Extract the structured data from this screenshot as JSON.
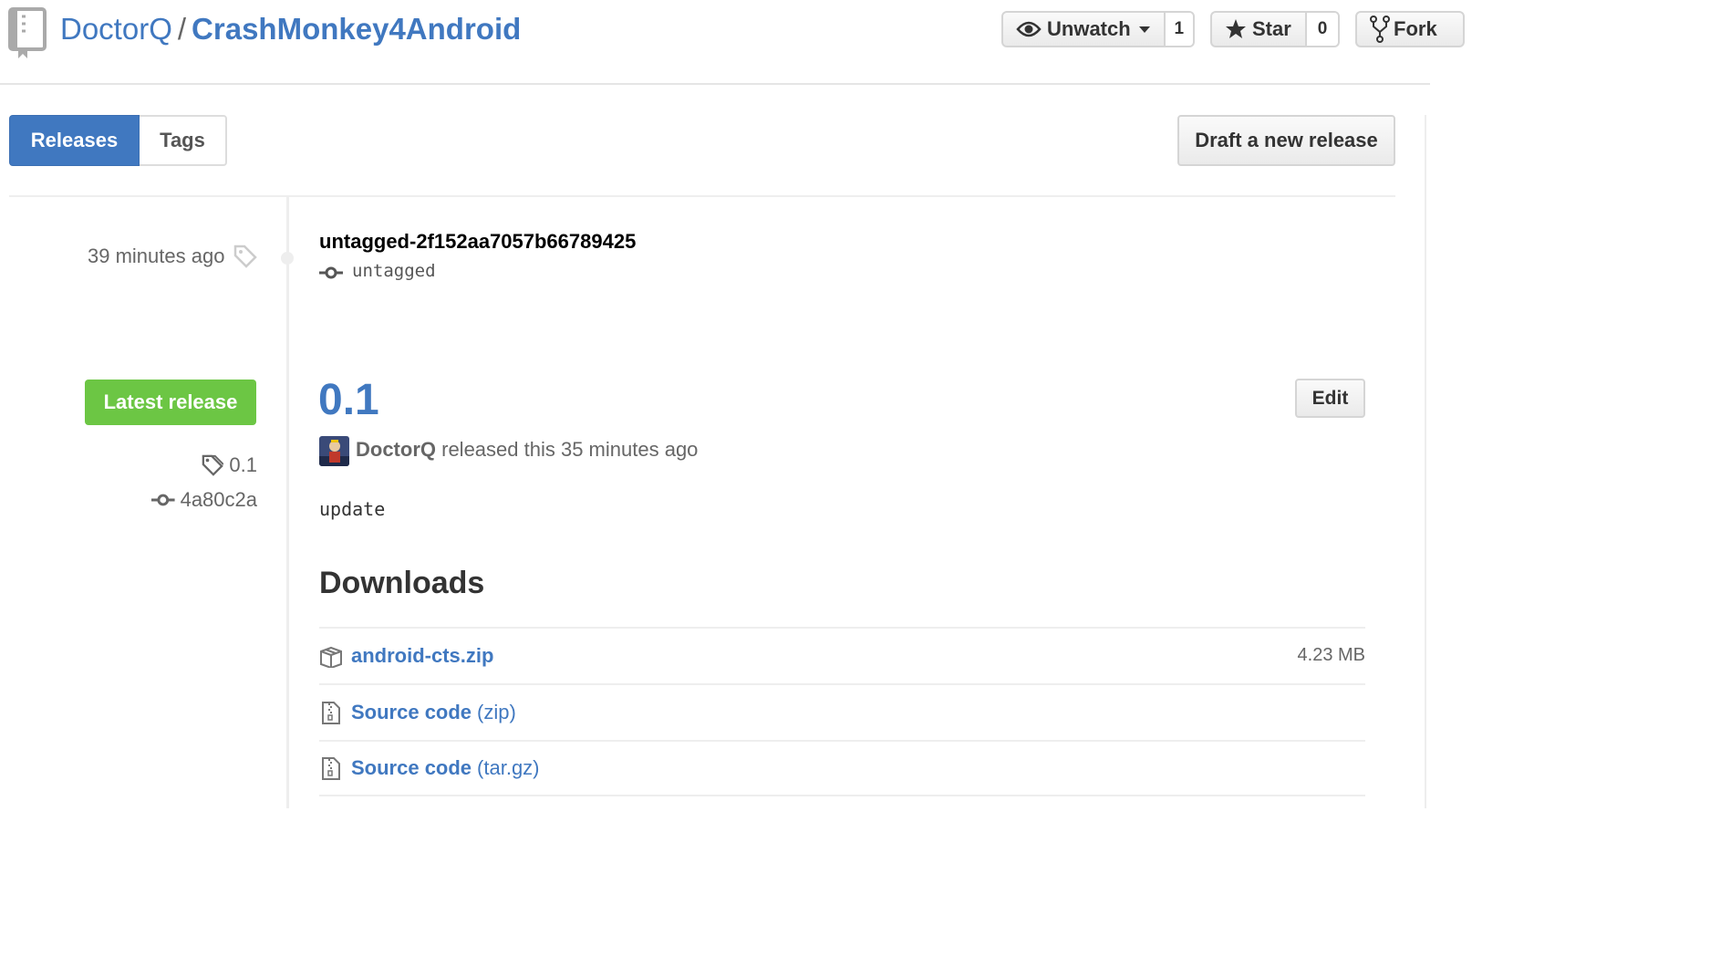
{
  "repo": {
    "owner": "DoctorQ",
    "separator": "/",
    "name": "CrashMonkey4Android"
  },
  "actions": {
    "watch": {
      "label": "Unwatch",
      "count": "1"
    },
    "star": {
      "label": "Star",
      "count": "0"
    },
    "fork": {
      "label": "Fork"
    }
  },
  "subnav": {
    "releases": "Releases",
    "tags": "Tags"
  },
  "draft_button": "Draft a new release",
  "untagged": {
    "time": "39 minutes ago",
    "title": "untagged-2f152aa7057b66789425",
    "label": "untagged"
  },
  "release": {
    "badge": "Latest release",
    "tag": "0.1",
    "commit": "4a80c2a",
    "version": "0.1",
    "edit": "Edit",
    "author": "DoctorQ",
    "released_text": "released this 35 minutes ago",
    "body": "update"
  },
  "downloads": {
    "heading": "Downloads",
    "items": [
      {
        "name": "android-cts.zip",
        "suffix": "",
        "size": "4.23 MB",
        "icon": "package-icon"
      },
      {
        "name": "Source code",
        "suffix": "(zip)",
        "size": "",
        "icon": "file-zip-icon"
      },
      {
        "name": "Source code",
        "suffix": "(tar.gz)",
        "size": "",
        "icon": "file-zip-icon"
      }
    ]
  },
  "colors": {
    "link": "#4078c0",
    "latest": "#6cc644",
    "active_tab": "#4078c0"
  }
}
